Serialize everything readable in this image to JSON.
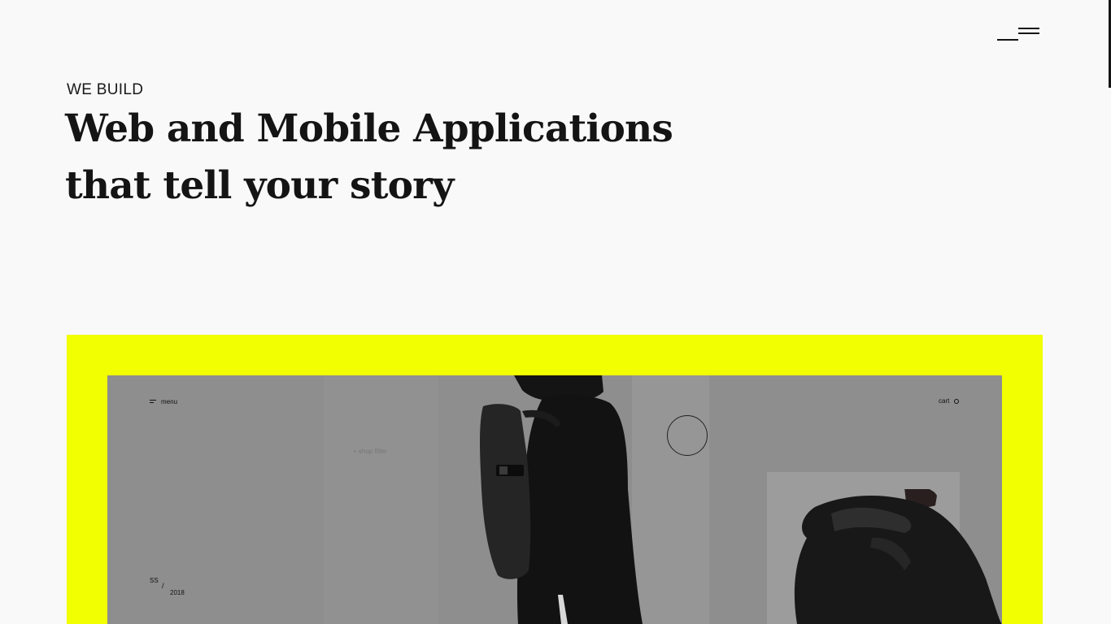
{
  "nav": {
    "menu_icon": "hamburger-icon"
  },
  "hero": {
    "eyebrow": "WE BUILD",
    "headline_line1": "Web and Mobile Applications",
    "headline_line2": "that tell your story"
  },
  "showcase": {
    "background": "#f2ff00",
    "mockup": {
      "menu_label": "menu",
      "cart_label": "cart",
      "filter_label": "+ shop filter",
      "season": "SS",
      "season_sep": "/",
      "year": "2018"
    }
  }
}
